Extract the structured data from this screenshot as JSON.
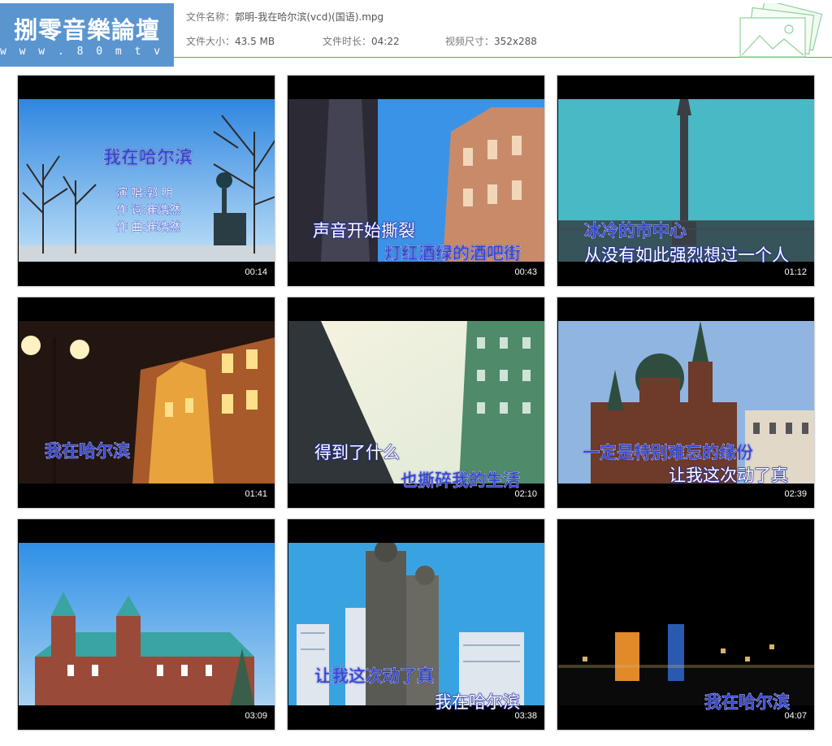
{
  "header": {
    "logo_title": "捌零音樂論壇",
    "logo_url": "w w w . 8 0 m t v . c o m",
    "filename_label": "文件名称：",
    "filename": "郭明-我在哈尔滨(vcd)(国语).mpg",
    "size_label": "文件大小：",
    "size": "43.5 MB",
    "duration_label": "文件时长：",
    "duration": "04:22",
    "dimension_label": "视频尺寸：",
    "dimension": "352x288",
    "accent_color": "#49b15a",
    "logo_color": "#5b95cf"
  },
  "thumbnails": [
    {
      "timestamp": "00:14",
      "scene": "winter-trees-lamp-blue-sky",
      "lines": [
        "我在哈尔滨"
      ],
      "credits": [
        "演 唱:郭 明",
        "作 词:崔浩然",
        "作 曲:崔浩然"
      ]
    },
    {
      "timestamp": "00:43",
      "scene": "european-buildings-street",
      "lines": [
        "声音开始撕裂",
        "灯红酒绿的酒吧街"
      ]
    },
    {
      "timestamp": "01:12",
      "scene": "monument-column-cyan-sky",
      "lines": [
        "冰冷的市中心",
        "从没有如此强烈想过一个人"
      ]
    },
    {
      "timestamp": "01:41",
      "scene": "night-street-lit-buildings",
      "lines": [
        "我在哈尔滨"
      ]
    },
    {
      "timestamp": "02:10",
      "scene": "elevated-road-buildings",
      "lines": [
        "得到了什么",
        "也撕碎我的生活"
      ]
    },
    {
      "timestamp": "02:39",
      "scene": "st-sophia-cathedral",
      "lines": [
        "一定是特别难忘的缘份",
        "让我这次动了真"
      ]
    },
    {
      "timestamp": "03:09",
      "scene": "green-roof-palace",
      "lines": []
    },
    {
      "timestamp": "03:38",
      "scene": "statue-skyscrapers",
      "lines": [
        "让我这次动了真",
        "我在哈尔滨"
      ]
    },
    {
      "timestamp": "04:07",
      "scene": "city-night-skyline",
      "lines": [
        "我在哈尔滨"
      ]
    }
  ]
}
